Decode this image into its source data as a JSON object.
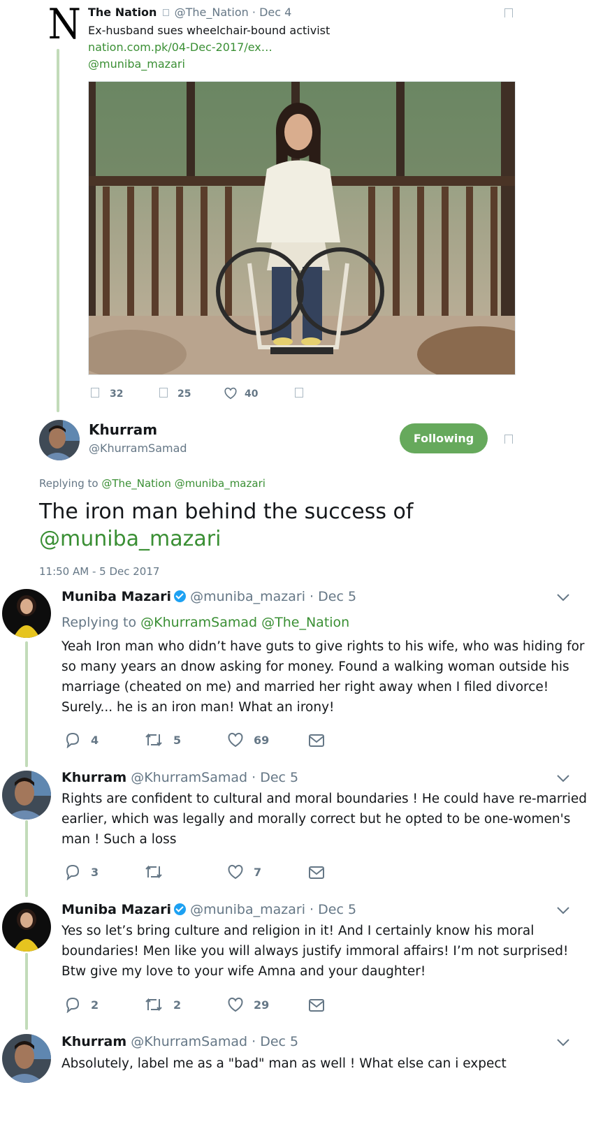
{
  "quoted": {
    "logo_letter": "N",
    "name": "The Nation",
    "handle": "@The_Nation",
    "sep": "·",
    "date": "Dec 4",
    "text": "Ex-husband sues wheelchair-bound activist",
    "link": "nation.com.pk/04-Dec-2017/ex…",
    "mention": "@muniba_mazari",
    "actions": {
      "reply_count": "32",
      "retweet_count": "25",
      "like_count": "40"
    }
  },
  "main": {
    "name": "Khurram",
    "handle": "@KhurramSamad",
    "follow_label": "Following",
    "replying_prefix": "Replying to",
    "replying_to_1": "@The_Nation",
    "replying_to_2": "@muniba_mazari",
    "text_line1": "The iron man behind the success of",
    "text_mention": "@muniba_mazari",
    "timestamp": "11:50 AM - 5 Dec 2017"
  },
  "replies": [
    {
      "name": "Muniba Mazari",
      "verified": true,
      "handle": "@muniba_mazari",
      "sep": "·",
      "date": "Dec 5",
      "replying_prefix": "Replying to",
      "replying_to_1": "@KhurramSamad",
      "replying_to_2": "@The_Nation",
      "lines": [
        "Yeah Iron man who didn’t have guts to give rights to his wife, who was hiding for",
        "so many years an dnow asking for money. Found a walking woman outside his",
        "marriage (cheated on me) and married her right away when I filed divorce!",
        "Surely... he is an iron man! What an irony!"
      ],
      "reply_count": "4",
      "retweet_count": "5",
      "like_count": "69"
    },
    {
      "name": "Khurram",
      "handle": "@KhurramSamad",
      "sep": "·",
      "date": "Dec 5",
      "lines": [
        "Rights are confident to cultural and moral boundaries ! He could have re-married",
        "earlier, which was legally and morally correct but he opted to be one-women's",
        "man ! Such a loss"
      ],
      "reply_count": "3",
      "retweet_count": "",
      "like_count": "7"
    },
    {
      "name": "Muniba Mazari",
      "verified": true,
      "handle": "@muniba_mazari",
      "sep": "·",
      "date": "Dec 5",
      "lines": [
        "Yes so let’s bring culture and religion in it! And I certainly know his moral",
        "boundaries! Men like you will always justify immoral affairs! I’m not surprised!",
        "Btw give my love to your wife Amna and your daughter!"
      ],
      "reply_count": "2",
      "retweet_count": "2",
      "like_count": "29"
    },
    {
      "name": "Khurram",
      "handle": "@KhurramSamad",
      "sep": "·",
      "date": "Dec 5",
      "lines": [
        "Absolutely, label me as a \"bad\" man as well ! What else can i expect"
      ]
    }
  ],
  "icons": {
    "reply": "reply-icon",
    "retweet": "retweet-icon",
    "like": "heart-icon",
    "dm": "envelope-icon",
    "more": "chevron-down-icon",
    "bookmark": "bookmark-icon",
    "verified": "verified-badge-icon"
  },
  "colors": {
    "link": "#3a8f34",
    "follow_button": "#66a95c",
    "thread_line": "#c2dbb9",
    "muted": "#657786",
    "verified": "#1da1f2"
  }
}
